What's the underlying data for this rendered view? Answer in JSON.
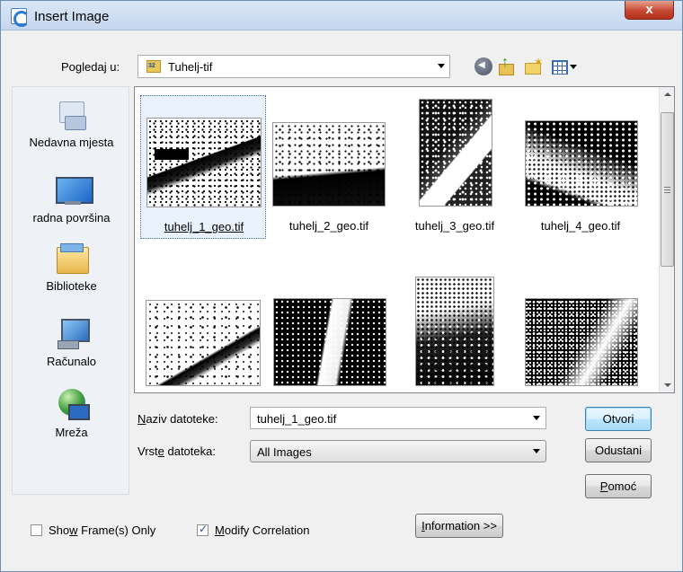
{
  "window": {
    "title": "Insert Image",
    "close_glyph": "x"
  },
  "lookin": {
    "label_pre": "Po",
    "label_accel": "g",
    "label_post": "ledaj u:",
    "value": "Tuhelj-tif"
  },
  "places": [
    {
      "label": "Nedavna mjesta",
      "icon": "recent-places-icon"
    },
    {
      "label": "radna površina",
      "icon": "desktop-icon"
    },
    {
      "label": "Biblioteke",
      "icon": "libraries-icon"
    },
    {
      "label": "Računalo",
      "icon": "computer-icon"
    },
    {
      "label": "Mreža",
      "icon": "network-icon"
    }
  ],
  "files": [
    {
      "name": "tuhelj_1_geo.tif",
      "selected": true
    },
    {
      "name": "tuhelj_2_geo.tif",
      "selected": false
    },
    {
      "name": "tuhelj_3_geo.tif",
      "selected": false
    },
    {
      "name": "tuhelj_4_geo.tif",
      "selected": false
    },
    {
      "name": "",
      "selected": false
    },
    {
      "name": "",
      "selected": false
    },
    {
      "name": "",
      "selected": false
    },
    {
      "name": "",
      "selected": false
    }
  ],
  "filename": {
    "label_accel": "N",
    "label_post": "aziv datoteke:",
    "value": "tuhelj_1_geo.tif"
  },
  "filetype": {
    "label_pre": "Vrst",
    "label_accel": "e",
    "label_post": " datoteka:",
    "value": "All Images"
  },
  "buttons": {
    "open": "Otvori",
    "cancel": "Odustani",
    "help_accel": "P",
    "help_post": "omoć",
    "info_accel": "I",
    "info_post": "nformation >>"
  },
  "options": {
    "show_frames_pre": "Sho",
    "show_frames_accel": "w",
    "show_frames_post": " Frame(s) Only",
    "show_frames_checked": false,
    "modify_corr_accel": "M",
    "modify_corr_post": "odify Correlation",
    "modify_corr_checked": true
  }
}
